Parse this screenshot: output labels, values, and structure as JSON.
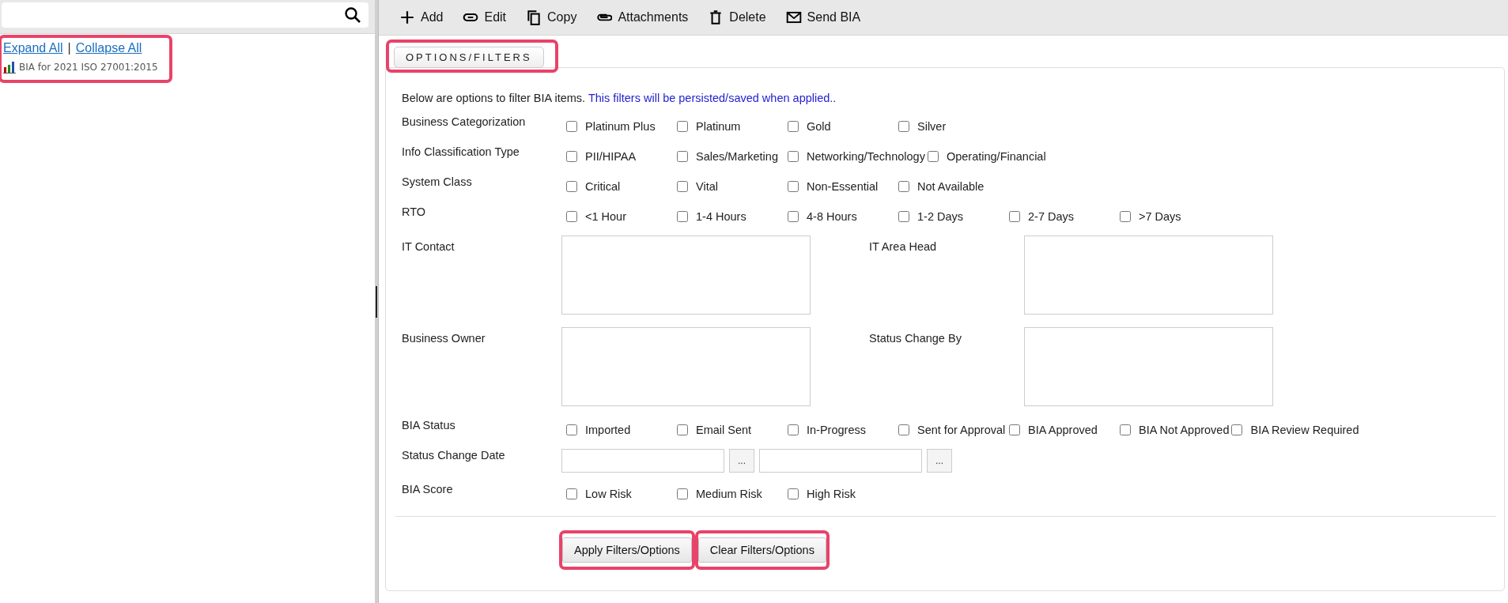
{
  "sidebar": {
    "highlighted": true,
    "links": [
      "Expand All",
      "Collapse All"
    ],
    "separator": "|",
    "items": [
      {
        "label": "BIA for 2021 ISO 27001:2015"
      }
    ]
  },
  "toolbar": [
    {
      "kind": "plus",
      "label": "Add"
    },
    {
      "kind": "link",
      "label": "Edit"
    },
    {
      "kind": "copy",
      "label": "Copy"
    },
    {
      "kind": "clip",
      "label": "Attachments"
    },
    {
      "kind": "trash",
      "label": "Delete"
    },
    {
      "kind": "mail",
      "label": "Send BIA"
    }
  ],
  "filters": {
    "legend": "OPTIONS/FILTERS",
    "legend_highlighted": true,
    "intro": "Below are options to filter BIA items.",
    "note": "This filters will be persisted/saved when applied..",
    "rows": [
      {
        "kind": "checkboxes",
        "label": "Business Categorization",
        "options": [
          {
            "label": "Platinum Plus",
            "checked": false
          },
          {
            "label": "Platinum",
            "checked": false
          },
          {
            "label": "Gold",
            "checked": false
          },
          {
            "label": "Silver",
            "checked": false
          }
        ]
      },
      {
        "kind": "checkboxes",
        "label": "Info Classification Type",
        "options": [
          {
            "label": "PII/HIPAA",
            "checked": false
          },
          {
            "label": "Sales/Marketing",
            "checked": false
          },
          {
            "label": "Networking/Technology",
            "checked": false
          },
          {
            "label": "Operating/Financial",
            "checked": false
          }
        ]
      },
      {
        "kind": "checkboxes",
        "label": "System Class",
        "options": [
          {
            "label": "Critical",
            "checked": false
          },
          {
            "label": "Vital",
            "checked": false
          },
          {
            "label": "Non-Essential",
            "checked": false
          },
          {
            "label": "Not Available",
            "checked": false
          }
        ]
      },
      {
        "kind": "checkboxes",
        "label": "RTO",
        "options": [
          {
            "label": "<1 Hour",
            "checked": false
          },
          {
            "label": "1-4 Hours",
            "checked": false
          },
          {
            "label": "4-8 Hours",
            "checked": false
          },
          {
            "label": "1-2 Days",
            "checked": false
          },
          {
            "label": "2-7 Days",
            "checked": false
          },
          {
            "label": ">7 Days",
            "checked": false
          }
        ]
      },
      {
        "kind": "people",
        "fields": [
          {
            "label": "IT Contact"
          },
          {
            "label": "IT Area Head"
          }
        ]
      },
      {
        "kind": "people",
        "fields": [
          {
            "label": "Business Owner"
          },
          {
            "label": "Status Change By"
          }
        ]
      },
      {
        "kind": "checkboxes",
        "label": "BIA Status",
        "options": [
          {
            "label": "Imported",
            "checked": false
          },
          {
            "label": "Email Sent",
            "checked": false
          },
          {
            "label": "In-Progress",
            "checked": false
          },
          {
            "label": "Sent for Approval",
            "checked": false
          },
          {
            "label": "BIA Approved",
            "checked": false
          },
          {
            "label": "BIA Not Approved",
            "checked": false
          },
          {
            "label": "BIA Review Required",
            "checked": false
          }
        ]
      },
      {
        "kind": "date_range",
        "label": "Status Change Date",
        "pickers": [
          "...",
          "..."
        ]
      },
      {
        "kind": "checkboxes",
        "label": "BIA Score",
        "options": [
          {
            "label": "Low Risk",
            "checked": false
          },
          {
            "label": "Medium Risk",
            "checked": false
          },
          {
            "label": "High Risk",
            "checked": false
          }
        ]
      }
    ],
    "buttons": [
      {
        "label": "Apply Filters/Options",
        "highlighted": true
      },
      {
        "label": "Clear Filters/Options",
        "highlighted": true
      }
    ]
  }
}
